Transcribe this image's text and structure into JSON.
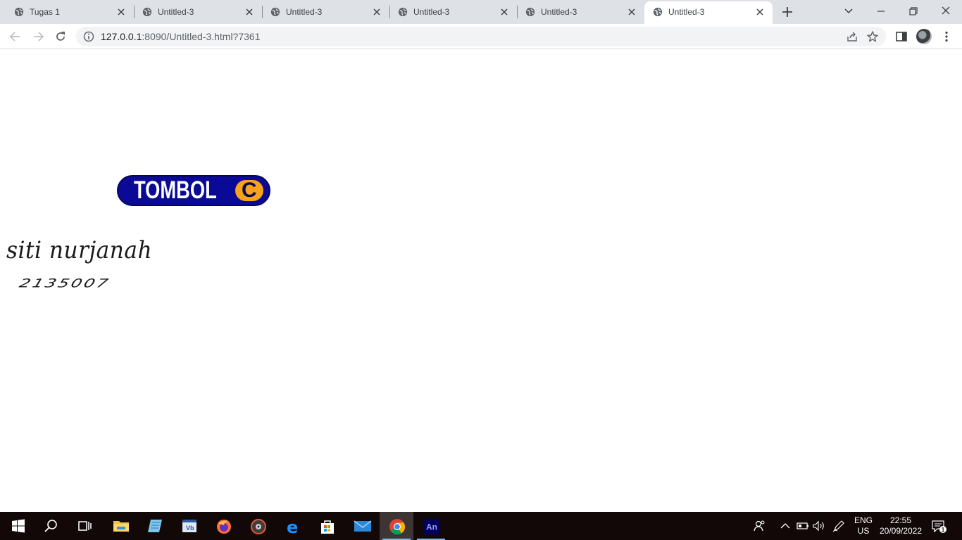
{
  "browser": {
    "tabs": [
      {
        "title": "Tugas 1",
        "active": false
      },
      {
        "title": "Untitled-3",
        "active": false
      },
      {
        "title": "Untitled-3",
        "active": false
      },
      {
        "title": "Untitled-3",
        "active": false
      },
      {
        "title": "Untitled-3",
        "active": false
      },
      {
        "title": "Untitled-3",
        "active": true
      }
    ],
    "address_bar": {
      "host": "127.0.0.1",
      "path": ":8090/Untitled-3.html?7361"
    }
  },
  "page": {
    "button": {
      "label": "TOMBOL",
      "badge": "C",
      "colors": {
        "fill": "#0a0a96",
        "badge": "#f7a21b",
        "text": "#ffffff"
      }
    },
    "author_name": "siti nurjanah",
    "student_id": "2135007"
  },
  "taskbar": {
    "apps": [
      "start-icon",
      "search-icon",
      "task-view-icon",
      "file-explorer-icon",
      "notepad-icon",
      "vb-icon",
      "firefox-icon",
      "media-player-icon",
      "edge-icon",
      "store-icon",
      "mail-icon",
      "chrome-icon",
      "animate-icon"
    ],
    "animate_label": "An",
    "language": {
      "line1": "ENG",
      "line2": "US"
    },
    "clock": {
      "time": "22:55",
      "date": "20/09/2022"
    },
    "notification_count": "1"
  },
  "theme": {
    "tabstrip_bg": "#dee1e6",
    "taskbar_bg": "#130808",
    "accent": "#1a73e8"
  }
}
